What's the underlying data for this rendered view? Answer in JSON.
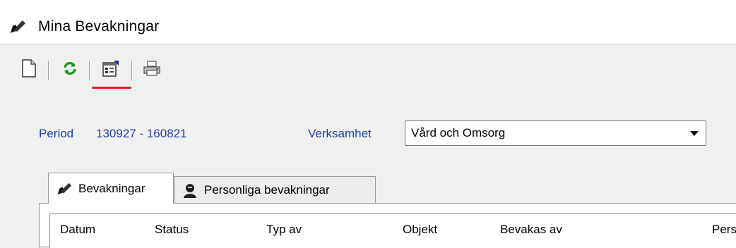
{
  "window": {
    "title": "Mina Bevakningar",
    "icon": "hand-pen-icon"
  },
  "toolbar": {
    "buttons": [
      {
        "name": "new-document-button",
        "icon": "page-icon"
      },
      {
        "name": "refresh-button",
        "icon": "refresh-icon"
      },
      {
        "name": "properties-button",
        "icon": "properties-icon",
        "active": true
      },
      {
        "name": "print-button",
        "icon": "printer-icon"
      }
    ]
  },
  "filters": {
    "period_label": "Period",
    "period_value": "130927 - 160821",
    "verksamhet_label": "Verksamhet",
    "verksamhet_value": "Vård och Omsorg"
  },
  "tabs": [
    {
      "label": "Bevakningar",
      "icon": "hand-pen-icon",
      "active": true
    },
    {
      "label": "Personliga bevakningar",
      "icon": "person-icon",
      "active": false
    }
  ],
  "grid": {
    "columns": [
      "Datum",
      "Status",
      "Typ av",
      "Objekt",
      "Bevakas av",
      "Pers"
    ]
  },
  "colors": {
    "label_blue": "#1f3f9f",
    "active_indicator": "#e02020",
    "refresh_green": "#1a9a1a"
  }
}
